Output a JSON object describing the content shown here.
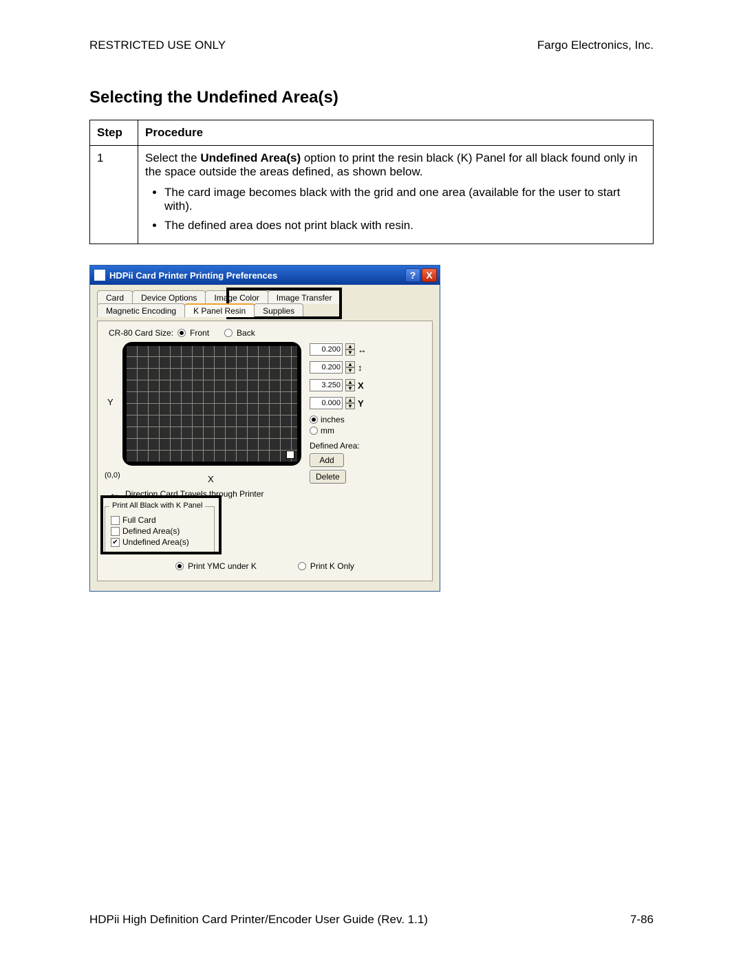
{
  "header": {
    "left": "RESTRICTED USE ONLY",
    "right": "Fargo Electronics, Inc."
  },
  "title": "Selecting the Undefined Area(s)",
  "table": {
    "head_step": "Step",
    "head_proc": "Procedure",
    "step": "1",
    "text_a": "Select the ",
    "text_bold": "Undefined Area(s)",
    "text_b": " option to print the resin black (K) Panel for all black found only in the space outside the areas defined, as shown below.",
    "bullet1": "The card image becomes black with the grid and one area (available for the user to start with).",
    "bullet2": "The defined area does not print black with resin."
  },
  "dialog": {
    "title": "HDPii Card Printer Printing Preferences",
    "help_icon": "?",
    "close_icon": "X",
    "tabs_row1": [
      "Card",
      "Device Options",
      "Image Color",
      "Image Transfer"
    ],
    "tabs_row2": [
      "Magnetic Encoding",
      "K Panel Resin",
      "Supplies"
    ],
    "active_tab": "K Panel Resin",
    "card_size_label": "CR-80 Card Size:",
    "front": "Front",
    "back": "Back",
    "ylabel": "Y",
    "xlabel": "X",
    "origin": "(0,0)",
    "direction": "Direction Card Travels through Printer",
    "spin": [
      {
        "val": "0.200",
        "icon": "↔"
      },
      {
        "val": "0.200",
        "icon": "↕"
      },
      {
        "val": "3.250",
        "icon": "X"
      },
      {
        "val": "0.000",
        "icon": "Y"
      }
    ],
    "units": {
      "inches": "inches",
      "mm": "mm"
    },
    "defined_area_label": "Defined Area:",
    "add": "Add",
    "delete": "Delete",
    "group": {
      "legend": "Print All Black with K Panel",
      "full": "Full Card",
      "def": "Defined Area(s)",
      "undef": "Undefined Area(s)"
    },
    "print_ymc": "Print YMC under K",
    "print_k": "Print K Only"
  },
  "footer": {
    "left": "HDPii High Definition Card Printer/Encoder User Guide (Rev. 1.1)",
    "right": "7-86"
  }
}
